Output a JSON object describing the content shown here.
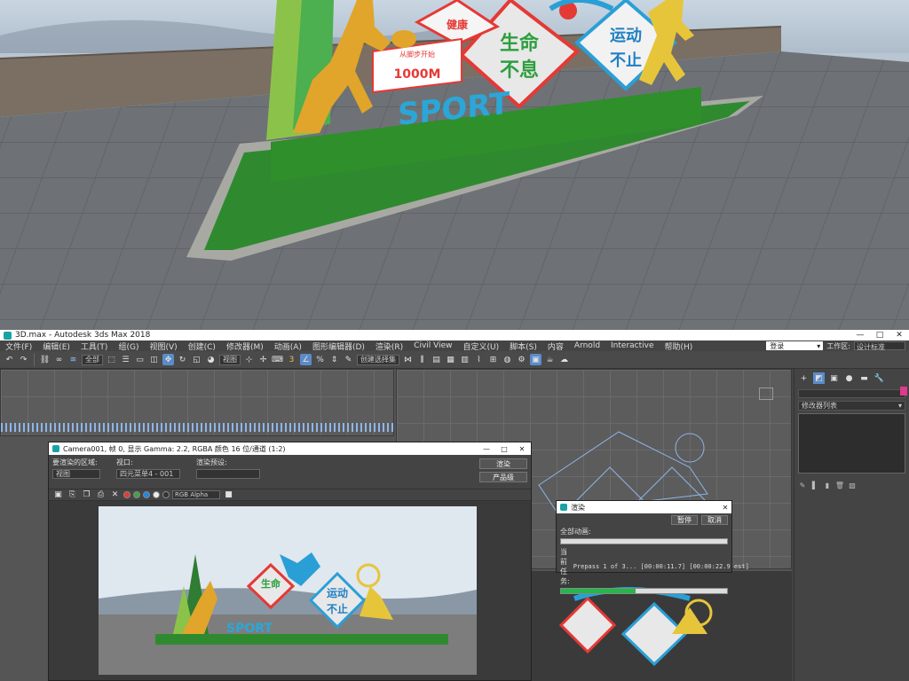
{
  "scene": {
    "sign_health": "健康",
    "sign_distance_top": "从脚步开始",
    "sign_distance": "1000M",
    "sign_life_1": "生命",
    "sign_life_2": "不息",
    "sign_motion_1": "运动",
    "sign_motion_2": "不止",
    "sign_sport": "SPORT"
  },
  "app": {
    "title": "3D.max - Autodesk 3ds Max 2018",
    "window_buttons": [
      "—",
      "□",
      "✕"
    ],
    "menu": [
      "文件(F)",
      "编辑(E)",
      "工具(T)",
      "组(G)",
      "视图(V)",
      "创建(C)",
      "修改器(M)",
      "动画(A)",
      "图形编辑器(D)",
      "渲染(R)",
      "Civil View",
      "自定义(U)",
      "脚本(S)",
      "内容",
      "Arnold",
      "Interactive",
      "帮助(H)"
    ],
    "login_label": "登录",
    "workspace_label": "工作区:",
    "workspace_value": "设计标准",
    "selection_filter": "全部",
    "view_select": "视图",
    "named_selection": "创建选择集",
    "modifier_list": "修改器列表"
  },
  "render_window": {
    "title": "Camera001, 帧 0, 显示 Gamma: 2.2, RGBA 颜色 16 位/通道 (1:2)",
    "area_label": "要渲染的区域:",
    "area_value": "视图",
    "viewport_label": "视口:",
    "viewport_value": "四元菜单4 - 001",
    "preset_label": "渲染预设:",
    "preset_value": "",
    "render_button": "渲染",
    "product_select": "产品级",
    "channel_select": "RGB Alpha"
  },
  "progress_dialog": {
    "title": "渲染",
    "pause_button": "暂停",
    "cancel_button": "取消",
    "overall_label": "全部动画:",
    "current_label": "当前任务:",
    "current_task": "Prepass 1 of 3... [00:00:11.7] [00:00:22.9 est]",
    "current_progress": 0.45
  },
  "colors": {
    "grass": "#2f8a2f",
    "accent_blue": "#5b8cc9",
    "progress_green": "#22b84a"
  }
}
